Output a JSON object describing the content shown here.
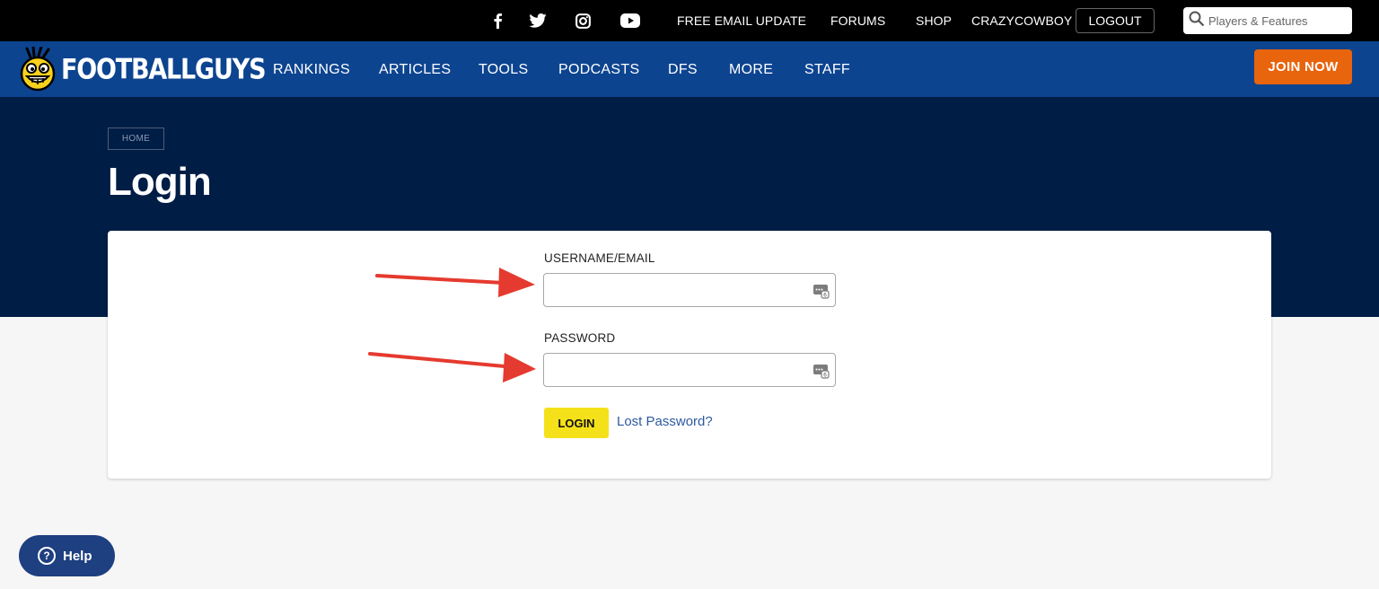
{
  "topbar": {
    "social_icons": [
      "facebook-icon",
      "twitter-icon",
      "instagram-icon",
      "youtube-icon"
    ],
    "links": {
      "email": "FREE EMAIL UPDATE",
      "forums": "FORUMS",
      "shop": "SHOP",
      "user": "CRAZYCOWBOY"
    },
    "logout_label": "LOGOUT",
    "search": {
      "placeholder": "Players & Features"
    }
  },
  "brand": {
    "name": "FOOTBALLGUYS"
  },
  "nav": {
    "items": [
      "RANKINGS",
      "ARTICLES",
      "TOOLS",
      "PODCASTS",
      "DFS",
      "MORE",
      "STAFF"
    ],
    "join_label": "JOIN NOW"
  },
  "hero": {
    "breadcrumb": "HOME",
    "title": "Login"
  },
  "form": {
    "username_label": "USERNAME/EMAIL",
    "username_value": "",
    "password_label": "PASSWORD",
    "password_value": "",
    "login_label": "LOGIN",
    "lost_password": "Lost Password?"
  },
  "help": {
    "label": "Help"
  },
  "colors": {
    "topbar": "#000000",
    "nav": "#0d4490",
    "hero": "#001d46",
    "join": "#e8640d",
    "login_button": "#f5e11a",
    "annotation_arrow": "#e53a2f"
  }
}
